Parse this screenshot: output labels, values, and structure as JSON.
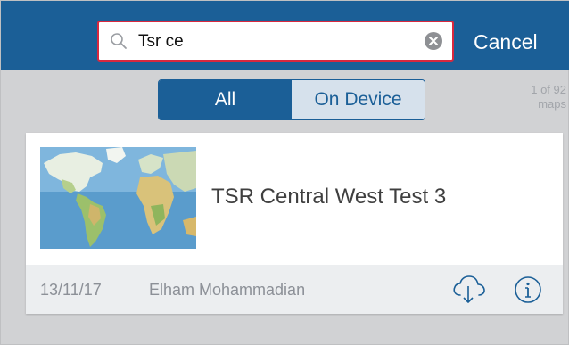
{
  "search": {
    "value": "Tsr ce",
    "cancel_label": "Cancel"
  },
  "filter": {
    "options": [
      "All",
      "On Device"
    ],
    "selected": "All"
  },
  "results": {
    "count_text": "1 of 92\nmaps"
  },
  "map_card": {
    "title": "TSR Central West Test 3",
    "date": "13/11/17",
    "author": "Elham Mohammadian"
  },
  "icons": {
    "search": "search-icon",
    "clear": "clear-icon",
    "download": "cloud-download-icon",
    "info": "info-icon"
  },
  "colors": {
    "navbar": "#1b5f97",
    "search_border": "#d8283f",
    "background": "#d1d2d4"
  }
}
